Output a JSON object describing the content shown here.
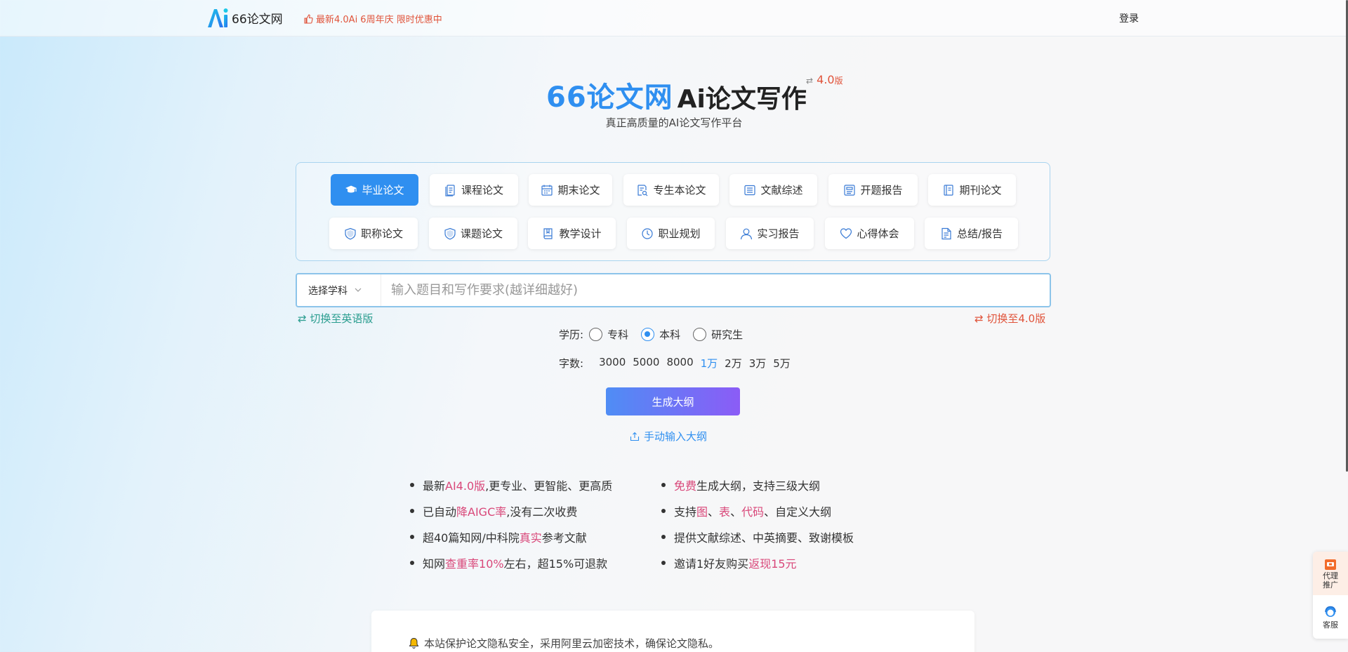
{
  "header": {
    "logo_text": "66论文网",
    "promo_text": "最新4.0Ai 6周年庆 限时优惠中",
    "login_label": "登录"
  },
  "hero": {
    "brand": "66论文网",
    "title": "Ai论文写作",
    "version_arrow": "⇄",
    "version_num": "4.0",
    "version_suffix": "版",
    "subtitle": "真正高质量的AI论文写作平台"
  },
  "paper_types": [
    {
      "label": "毕业论文",
      "icon": "graduation-cap-icon",
      "active": true
    },
    {
      "label": "课程论文",
      "icon": "document-icon"
    },
    {
      "label": "期末论文",
      "icon": "calendar-icon"
    },
    {
      "label": "专生本论文",
      "icon": "doc-search-icon"
    },
    {
      "label": "文献综述",
      "icon": "book-list-icon"
    },
    {
      "label": "开题报告",
      "icon": "report-icon"
    },
    {
      "label": "期刊论文",
      "icon": "journal-icon"
    },
    {
      "label": "职称论文",
      "icon": "shield-icon"
    },
    {
      "label": "课题论文",
      "icon": "shield-icon"
    },
    {
      "label": "教学设计",
      "icon": "book-icon"
    },
    {
      "label": "职业规划",
      "icon": "clock-icon"
    },
    {
      "label": "实习报告",
      "icon": "user-icon"
    },
    {
      "label": "心得体会",
      "icon": "heart-icon"
    },
    {
      "label": "总结/报告",
      "icon": "summary-doc-icon"
    }
  ],
  "input": {
    "subject_label": "选择学科",
    "placeholder": "输入题目和写作要求(越详细越好)"
  },
  "switches": {
    "english": "⇄ 切换至英语版",
    "v40": "⇄ 切换至4.0版"
  },
  "education": {
    "label": "学历:",
    "options": [
      "专科",
      "本科",
      "研究生"
    ],
    "selected": "本科"
  },
  "word_count": {
    "label": "字数:",
    "options": [
      "3000",
      "5000",
      "8000",
      "1万",
      "2万",
      "3万",
      "5万"
    ],
    "selected": "1万"
  },
  "actions": {
    "generate": "生成大纲",
    "manual": "手动输入大纲"
  },
  "features_left": [
    {
      "parts": [
        {
          "t": "最新"
        },
        {
          "t": "AI4.0版",
          "hl": true
        },
        {
          "t": ",更专业、更智能、更高质"
        }
      ]
    },
    {
      "parts": [
        {
          "t": "已自动"
        },
        {
          "t": "降AIGC率",
          "hl": true
        },
        {
          "t": ",没有二次收费"
        }
      ]
    },
    {
      "parts": [
        {
          "t": "超40篇知网/中科院"
        },
        {
          "t": "真实",
          "hl": true
        },
        {
          "t": "参考文献"
        }
      ]
    },
    {
      "parts": [
        {
          "t": "知网"
        },
        {
          "t": "查重率10%",
          "hl": true
        },
        {
          "t": "左右，超15%可退款"
        }
      ]
    }
  ],
  "features_right": [
    {
      "parts": [
        {
          "t": "免费",
          "hl": true
        },
        {
          "t": "生成大纲，支持三级大纲"
        }
      ]
    },
    {
      "parts": [
        {
          "t": "支持"
        },
        {
          "t": "图",
          "hl": true
        },
        {
          "t": "、"
        },
        {
          "t": "表",
          "hl": true
        },
        {
          "t": "、"
        },
        {
          "t": "代码",
          "hl": true
        },
        {
          "t": "、自定义大纲"
        }
      ]
    },
    {
      "parts": [
        {
          "t": "提供文献综述、中英摘要、致谢模板"
        }
      ]
    },
    {
      "parts": [
        {
          "t": "邀请1好友购买"
        },
        {
          "t": "返现15元",
          "hl": true
        }
      ]
    }
  ],
  "privacy_text": "本站保护论文隐私安全，采用阿里云加密技术，确保论文隐私。",
  "side_widget": {
    "agent": "代理推广",
    "service": "客服"
  },
  "colors": {
    "accent": "#2f8ff0",
    "promo": "#e0533a",
    "highlight": "#d9487a",
    "english_switch": "#2a9d8f"
  }
}
